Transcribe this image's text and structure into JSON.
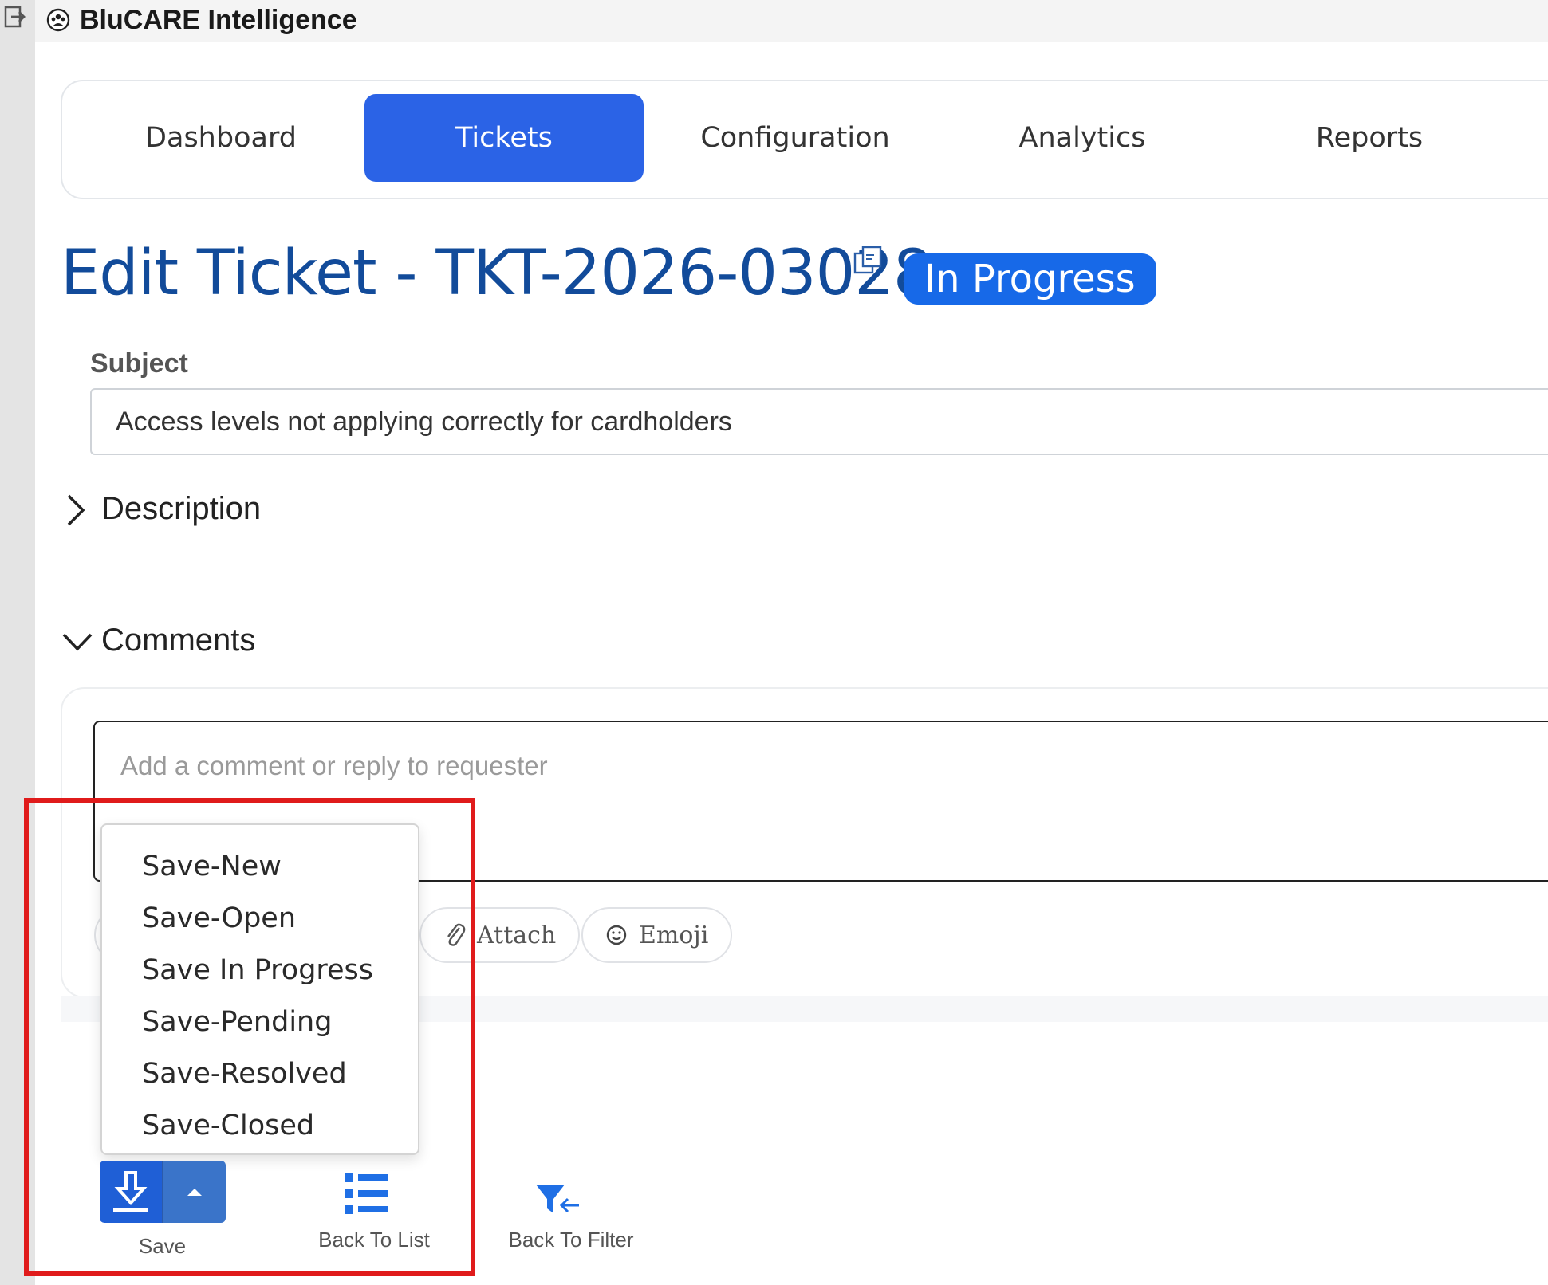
{
  "app": {
    "title": "BluCARE Intelligence"
  },
  "nav": {
    "tabs": [
      {
        "label": "Dashboard",
        "active": false
      },
      {
        "label": "Tickets",
        "active": true
      },
      {
        "label": "Configuration",
        "active": false
      },
      {
        "label": "Analytics",
        "active": false
      },
      {
        "label": "Reports",
        "active": false
      }
    ]
  },
  "ticket": {
    "title": "Edit Ticket - TKT-2026-03028",
    "status": "In Progress",
    "status_color": "#1769e8"
  },
  "subject": {
    "label": "Subject",
    "value": "Access levels not applying correctly for cardholders"
  },
  "sections": {
    "description": "Description",
    "comments": "Comments"
  },
  "comment": {
    "placeholder": "Add a comment or reply to requester",
    "attach_label": "Attach",
    "emoji_label": "Emoji"
  },
  "save_menu": {
    "items": [
      "Save-New",
      "Save-Open",
      "Save In Progress",
      "Save-Pending",
      "Save-Resolved",
      "Save-Closed"
    ]
  },
  "toolbar": {
    "save_label": "Save",
    "back_to_list_label": "Back To List",
    "back_to_filter_label": "Back To Filter"
  },
  "colors": {
    "accent": "#2b63e6",
    "title": "#124b9a",
    "highlight": "#e01b1b"
  }
}
